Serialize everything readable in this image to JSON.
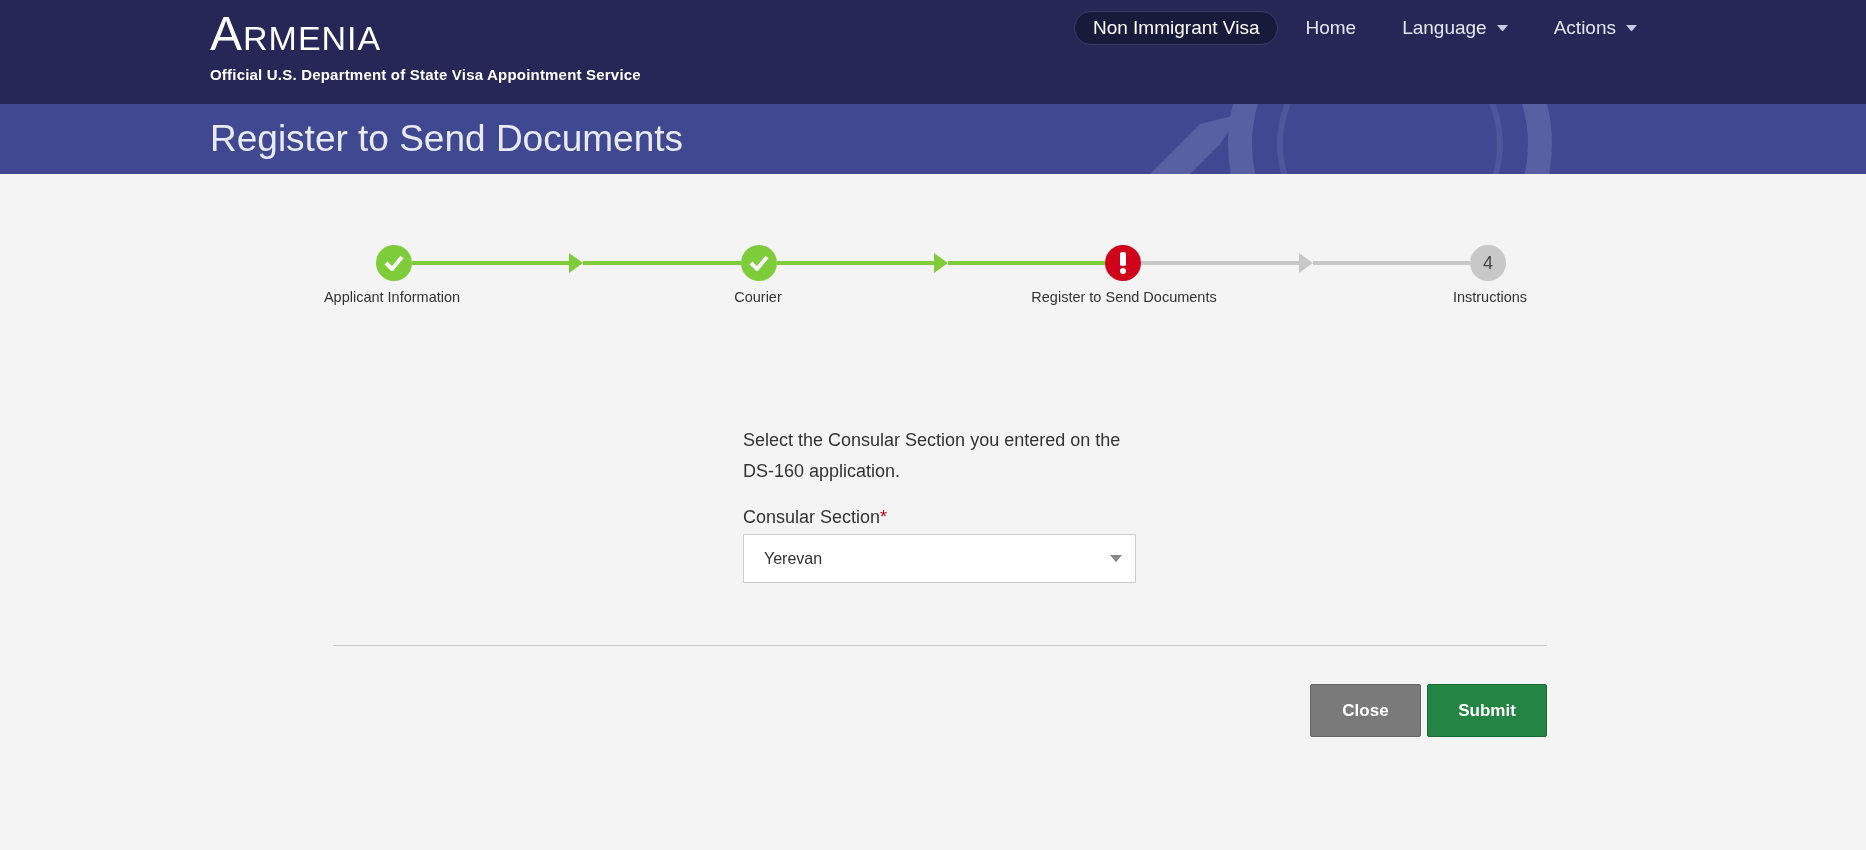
{
  "header": {
    "title": "Armenia",
    "subtitle": "Official U.S. Department of State Visa Appointment Service",
    "nav": [
      {
        "label": "Non Immigrant Visa",
        "selected": true,
        "dropdown": false
      },
      {
        "label": "Home",
        "selected": false,
        "dropdown": false
      },
      {
        "label": "Language",
        "selected": false,
        "dropdown": true
      },
      {
        "label": "Actions",
        "selected": false,
        "dropdown": true
      }
    ]
  },
  "page_title": "Register to Send Documents",
  "steps": [
    {
      "label": "Applicant Information",
      "kind": "done"
    },
    {
      "label": "Courier",
      "kind": "done"
    },
    {
      "label": "Register to Send Documents",
      "kind": "error"
    },
    {
      "label": "Instructions",
      "kind": "pending",
      "number": "4"
    }
  ],
  "form": {
    "instruction": "Select the Consular Section you entered on the DS-160 application.",
    "field": {
      "label": "Consular Section",
      "required_mark": "*",
      "value": "Yerevan"
    }
  },
  "buttons": [
    {
      "label": "Close",
      "kind": "secondary"
    },
    {
      "label": "Submit",
      "kind": "primary"
    }
  ]
}
